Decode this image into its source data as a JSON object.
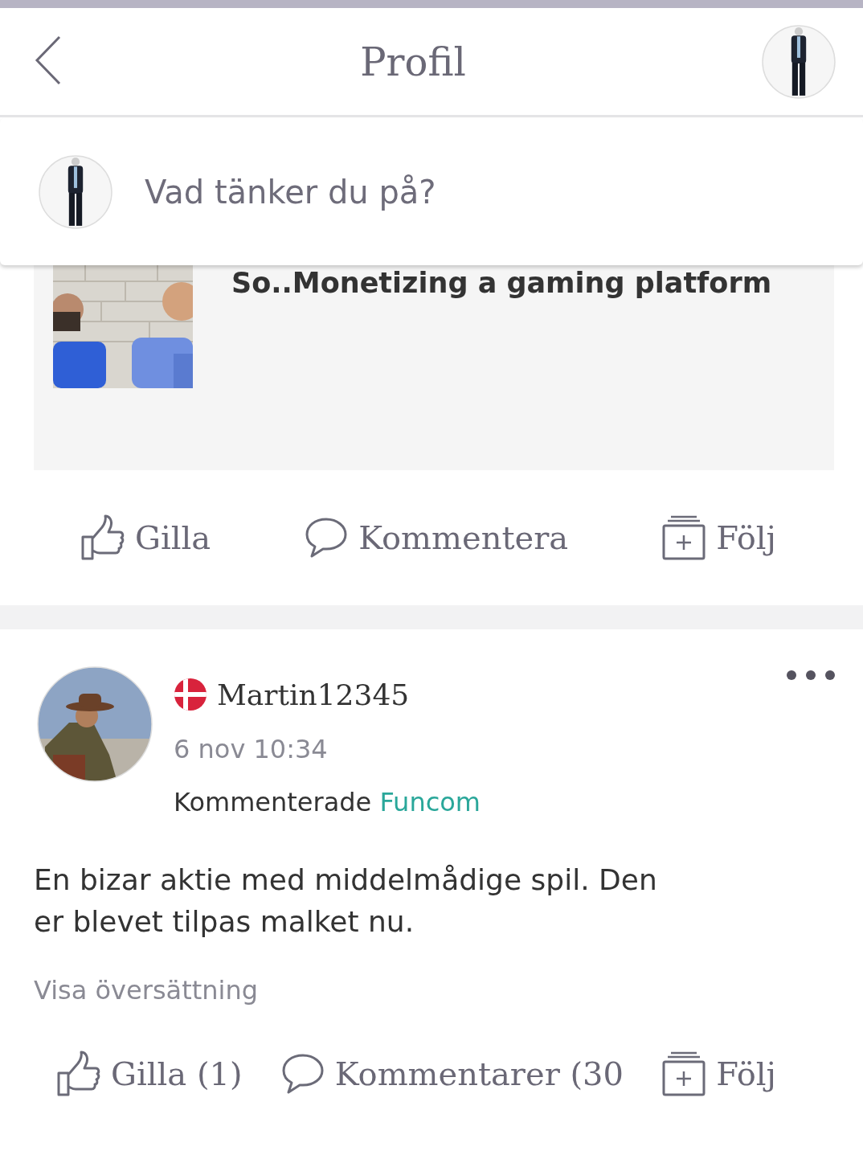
{
  "header": {
    "title": "Profil"
  },
  "composer": {
    "placeholder": "Vad tänker du på?"
  },
  "posts": [
    {
      "kind": "shared",
      "shared_title": "So..Monetizing a gaming platform",
      "actions": [
        {
          "kind": "like",
          "label": "Gilla"
        },
        {
          "kind": "comment",
          "label": "Kommentera"
        },
        {
          "kind": "follow",
          "label": "Följ"
        }
      ]
    },
    {
      "kind": "comment",
      "author": "Martin12345",
      "time": "6 nov 10:34",
      "activity": "Kommenterade",
      "target": "Funcom",
      "text": "En bizar aktie med middelmådige spil. Den er blevet tilpas malket nu.",
      "translate": "Visa översättning",
      "actions": [
        {
          "kind": "like",
          "label": "Gilla (1)"
        },
        {
          "kind": "comment",
          "label": "Kommentarer (30"
        },
        {
          "kind": "follow",
          "label": "Följ"
        }
      ]
    }
  ]
}
